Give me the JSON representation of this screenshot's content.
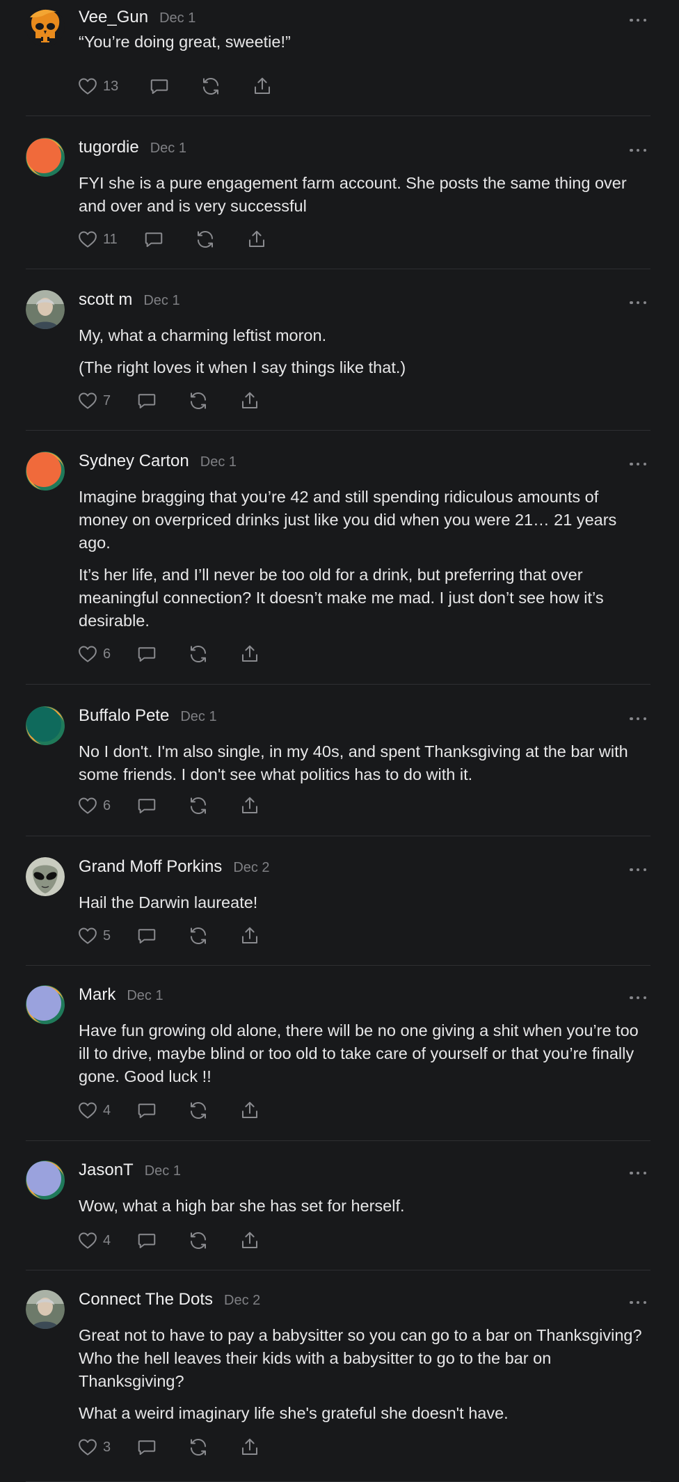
{
  "comments": [
    {
      "user": "Vee_Gun",
      "date": "Dec 1",
      "avatar": "orange-skull-avatar",
      "paragraphs": [
        "“You’re doing great, sweetie!”"
      ],
      "likes": "13"
    },
    {
      "user": "tugordie",
      "date": "Dec 1",
      "avatar": "default-orange-avatar",
      "paragraphs": [
        "FYI she is a pure engagement farm account. She posts the same thing over and over and is very successful"
      ],
      "likes": "11"
    },
    {
      "user": "scott m",
      "date": "Dec 1",
      "avatar": "photo-avatar",
      "paragraphs": [
        "My, what a charming leftist moron.",
        "(The right loves it when I say things like that.)"
      ],
      "likes": "7"
    },
    {
      "user": "Sydney Carton",
      "date": "Dec 1",
      "avatar": "default-orange-avatar",
      "paragraphs": [
        "Imagine bragging that you’re 42 and still spending ridiculous amounts of money on overpriced drinks just like you did when you were 21… 21 years ago.",
        "It’s her life, and I’ll never be too old for a drink, but preferring that over meaningful connection? It doesn’t make me mad. I just don’t see how it’s desirable."
      ],
      "likes": "6"
    },
    {
      "user": "Buffalo Pete",
      "date": "Dec 1",
      "avatar": "default-teal-avatar",
      "paragraphs": [
        "No I don't. I'm also single, in my 40s, and spent Thanksgiving at the bar with some friends. I don't see what politics has to do with it."
      ],
      "likes": "6"
    },
    {
      "user": "Grand Moff Porkins",
      "date": "Dec 2",
      "avatar": "alien-avatar",
      "paragraphs": [
        "Hail the Darwin laureate!"
      ],
      "likes": "5"
    },
    {
      "user": "Mark",
      "date": "Dec 1",
      "avatar": "default-lavender-avatar",
      "paragraphs": [
        "Have fun growing old alone, there will be no one giving a shit when you’re too ill to drive, maybe blind or too old to take care of yourself or that you’re finally gone. Good luck !!"
      ],
      "likes": "4"
    },
    {
      "user": "JasonT",
      "date": "Dec 1",
      "avatar": "default-lavender-avatar",
      "paragraphs": [
        "Wow, what a high bar she has set for herself."
      ],
      "likes": "4"
    },
    {
      "user": "Connect The Dots",
      "date": "Dec 2",
      "avatar": "photo-avatar",
      "paragraphs": [
        "Great not to have to pay a babysitter so you can go to a bar on Thanksgiving? Who the hell leaves their kids with a babysitter to go to the bar on Thanksgiving?",
        "What a weird imaginary life she's grateful she doesn't have."
      ],
      "likes": "3"
    }
  ],
  "icons": {
    "like": "heart-icon",
    "reply": "comment-bubble-icon",
    "restack": "restack-icon",
    "share": "share-icon",
    "more": "more-dots-icon"
  },
  "colors": {
    "background": "#18191b",
    "text": "#e7e7e8",
    "muted": "#86878b",
    "divider": "#2e2f32",
    "accent_orange": "#f06a3b"
  }
}
